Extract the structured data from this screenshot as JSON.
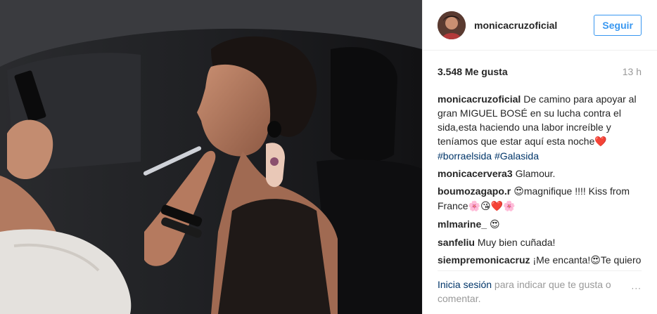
{
  "header": {
    "username": "monicacruzoficial",
    "follow_label": "Seguir"
  },
  "meta": {
    "likes": "3.548 Me gusta",
    "time": "13 h"
  },
  "caption": {
    "username": "monicacruzoficial",
    "text": "De camino para apoyar al gran MIGUEL BOSÉ en su lucha contra el sida,esta haciendo una labor increíble y teníamos que estar aquí esta noche",
    "emoji": "❤️",
    "hashtags": [
      "#borraelsida",
      "#Galasida"
    ]
  },
  "comments": [
    {
      "username": "monicacervera3",
      "text": "Glamour."
    },
    {
      "username": "boumozagapo.r",
      "emoji_before": "😍",
      "text": "magnifique !!!! Kiss from France",
      "emoji_after": "🌸😘❤️🌸"
    },
    {
      "username": "mlmarine_",
      "text": "",
      "emoji_after": "😍"
    },
    {
      "username": "sanfeliu",
      "text": "Muy bien cuñada!"
    },
    {
      "username": "siempremonicacruz",
      "text": "¡Me encanta!",
      "emoji_mid": "😍",
      "text_after": "Te quiero",
      "emoji_after": "😘"
    }
  ],
  "footer": {
    "login_link": "Inicia sesión",
    "rest": " para indicar que te gusta o comentar.",
    "more_icon": "···"
  },
  "colors": {
    "accent": "#3897f0",
    "link": "#003569",
    "muted": "#999999"
  }
}
